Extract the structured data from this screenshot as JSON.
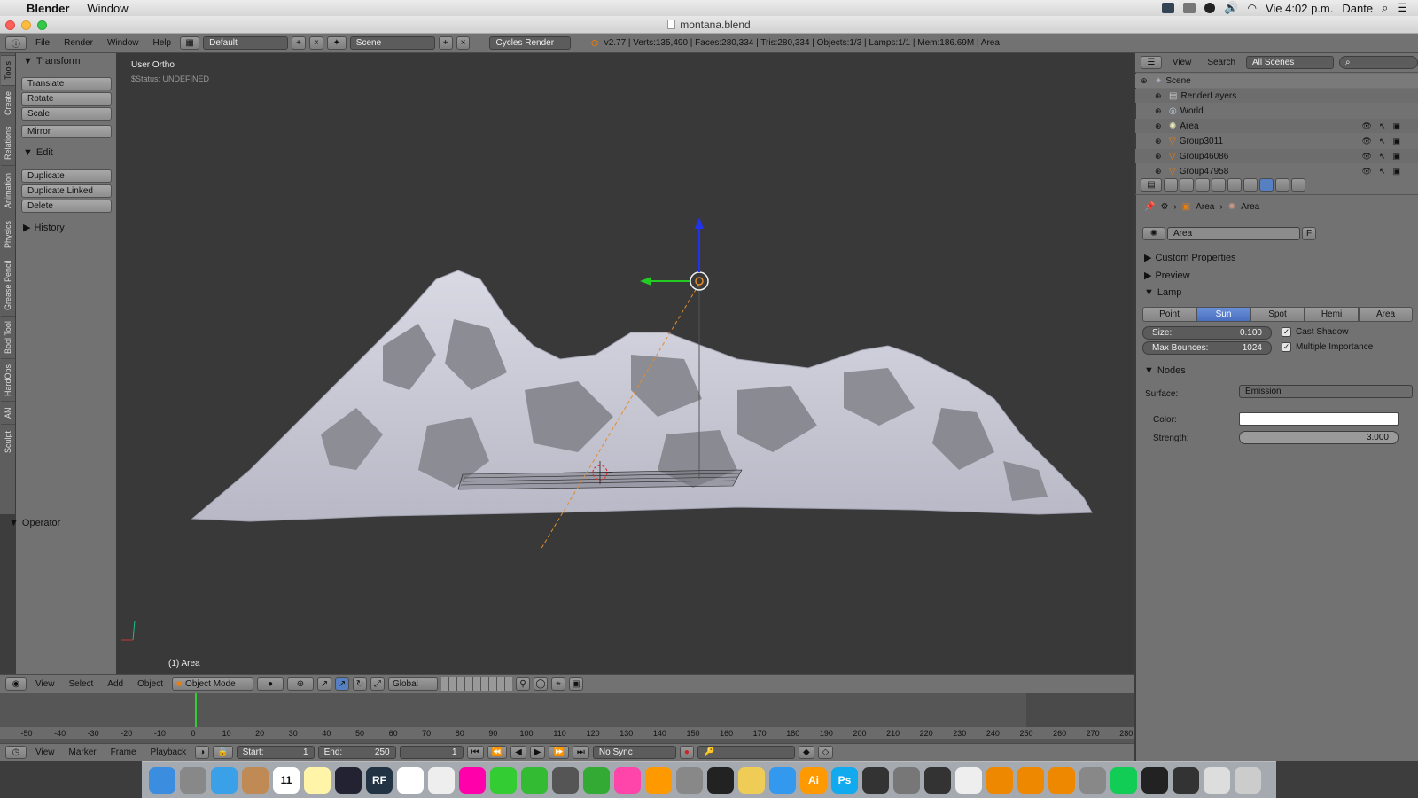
{
  "mac_menubar": {
    "apple": "",
    "app_name": "Blender",
    "menu_window": "Window",
    "clock": "Vie 4:02 p.m.",
    "user": "Dante"
  },
  "window": {
    "title": "montana.blend"
  },
  "info_header": {
    "menus": [
      "File",
      "Render",
      "Window",
      "Help"
    ],
    "layout": "Default",
    "scene": "Scene",
    "engine": "Cycles Render",
    "stats": "v2.77 | Verts:135,490 | Faces:280,334 | Tris:280,334 | Objects:1/3 | Lamps:1/1 | Mem:186.69M | Area"
  },
  "tool_tabs": [
    "Tools",
    "Create",
    "Relations",
    "Animation",
    "Physics",
    "Grease Pencil",
    "Bool Tool",
    "HardOps",
    "AN",
    "Sculpt"
  ],
  "tool_shelf": {
    "transform_header": "Transform",
    "transform_buttons": [
      "Translate",
      "Rotate",
      "Scale",
      "Mirror"
    ],
    "edit_header": "Edit",
    "edit_buttons": [
      "Duplicate",
      "Duplicate Linked",
      "Delete"
    ],
    "history_header": "History",
    "operator_header": "Operator"
  },
  "viewport": {
    "view_label": "User Ortho",
    "status": "$Status: UNDEFINED",
    "object_label": "(1) Area"
  },
  "view3d_header": {
    "menus": [
      "View",
      "Select",
      "Add",
      "Object"
    ],
    "mode": "Object Mode",
    "orientation": "Global"
  },
  "timeline": {
    "ruler_labels": [
      "-50",
      "-40",
      "-30",
      "-20",
      "-10",
      "0",
      "10",
      "20",
      "30",
      "40",
      "50",
      "60",
      "70",
      "80",
      "90",
      "100",
      "110",
      "120",
      "130",
      "140",
      "150",
      "160",
      "170",
      "180",
      "190",
      "200",
      "210",
      "220",
      "230",
      "240",
      "250",
      "260",
      "270",
      "280"
    ],
    "current_frame_marker": 0,
    "menus": [
      "View",
      "Marker",
      "Frame",
      "Playback"
    ],
    "start_label": "Start:",
    "start_value": "1",
    "end_label": "End:",
    "end_value": "250",
    "current_value": "1",
    "sync": "No Sync"
  },
  "outliner": {
    "menus": [
      "View",
      "Search"
    ],
    "scenes_select": "All Scenes",
    "items": [
      {
        "label": "Scene",
        "depth": 0
      },
      {
        "label": "RenderLayers",
        "depth": 1
      },
      {
        "label": "World",
        "depth": 1
      },
      {
        "label": "Area",
        "depth": 1
      },
      {
        "label": "Group3011",
        "depth": 1
      },
      {
        "label": "Group46086",
        "depth": 1
      },
      {
        "label": "Group47958",
        "depth": 1
      }
    ]
  },
  "properties": {
    "breadcrumb": [
      "Area",
      "Area"
    ],
    "datablock_name": "Area",
    "fake_user": "F",
    "panels": {
      "custom_properties": "Custom Properties",
      "preview": "Preview",
      "lamp": "Lamp",
      "nodes": "Nodes"
    },
    "lamp_types": [
      "Point",
      "Sun",
      "Spot",
      "Hemi",
      "Area"
    ],
    "active_lamp_type": "Sun",
    "size_label": "Size:",
    "size_value": "0.100",
    "max_bounces_label": "Max Bounces:",
    "max_bounces_value": "1024",
    "cast_shadow": "Cast Shadow",
    "multiple_importance": "Multiple Importance",
    "surface_label": "Surface:",
    "surface_value": "Emission",
    "color_label": "Color:",
    "color_value": "#ffffff",
    "strength_label": "Strength:",
    "strength_value": "3.000"
  },
  "dock": {
    "apps": [
      "finder",
      "launchpad",
      "safari",
      "contacts",
      "calendar",
      "notes",
      "cinema4d",
      "realflow",
      "textedit",
      "preview",
      "photos",
      "messages",
      "facetime",
      "feather",
      "numbers",
      "itunes",
      "ibooks",
      "system-preferences",
      "blender-app",
      "stickies",
      "keynote",
      "illustrator",
      "photoshop",
      "mixamo",
      "image-capture",
      "quicktime",
      "chrome",
      "blender-1",
      "blender-2",
      "blender-3",
      "automator",
      "spotify",
      "screenshot",
      "claquette",
      "stacks",
      "trash"
    ],
    "labels": {
      "realflow": "RF",
      "illustrator": "Ai",
      "photoshop": "Ps",
      "calendar": "11"
    }
  }
}
